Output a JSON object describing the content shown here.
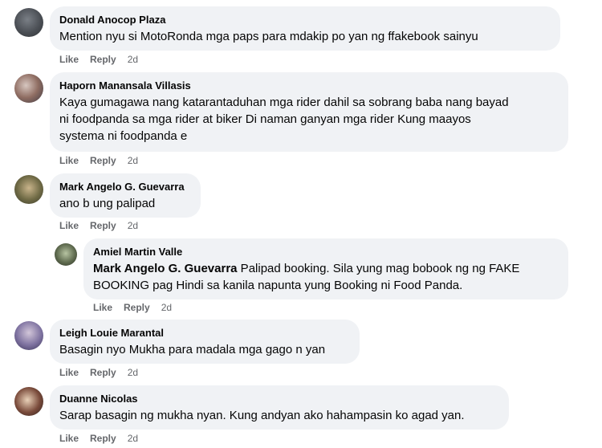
{
  "comments": [
    {
      "name": "Donald Anocop Plaza",
      "text": "Mention nyu si MotoRonda mga paps para mdakip po yan ng ffakebook sainyu",
      "like": "Like",
      "reply": "Reply",
      "time": "2d",
      "avatar_icon": "profile-photo"
    },
    {
      "name": "Haporn Manansala Villasis",
      "text_lines": [
        "Kaya gumagawa nang katarantaduhan mga rider dahil sa sobrang baba nang bayad",
        "ni foodpanda sa mga rider at biker Di naman ganyan mga rider Kung maayos",
        "systema ni foodpanda e"
      ],
      "like": "Like",
      "reply": "Reply",
      "time": "2d",
      "avatar_icon": "profile-photo"
    },
    {
      "name": "Mark Angelo G. Guevarra",
      "text": "ano b ung palipad",
      "like": "Like",
      "reply": "Reply",
      "time": "2d",
      "avatar_icon": "profile-photo"
    },
    {
      "name": "Amiel Martin Valle",
      "mention": "Mark Angelo G. Guevarra",
      "text_line1_rest": " Palipad booking. Sila yung mag bobook ng ng FAKE",
      "text_line2": "BOOKING pag Hindi sa kanila napunta yung Booking ni Food Panda.",
      "like": "Like",
      "reply": "Reply",
      "time": "2d",
      "avatar_icon": "profile-photo"
    },
    {
      "name": "Leigh Louie Marantal",
      "text": "Basagin nyo Mukha para madala mga gago n yan",
      "like": "Like",
      "reply": "Reply",
      "time": "2d",
      "avatar_icon": "profile-photo"
    },
    {
      "name": "Duanne Nicolas",
      "text": "Sarap basagin ng mukha nyan. Kung andyan ako hahampasin ko agad yan.",
      "like": "Like",
      "reply": "Reply",
      "time": "2d",
      "avatar_icon": "profile-photo"
    }
  ]
}
